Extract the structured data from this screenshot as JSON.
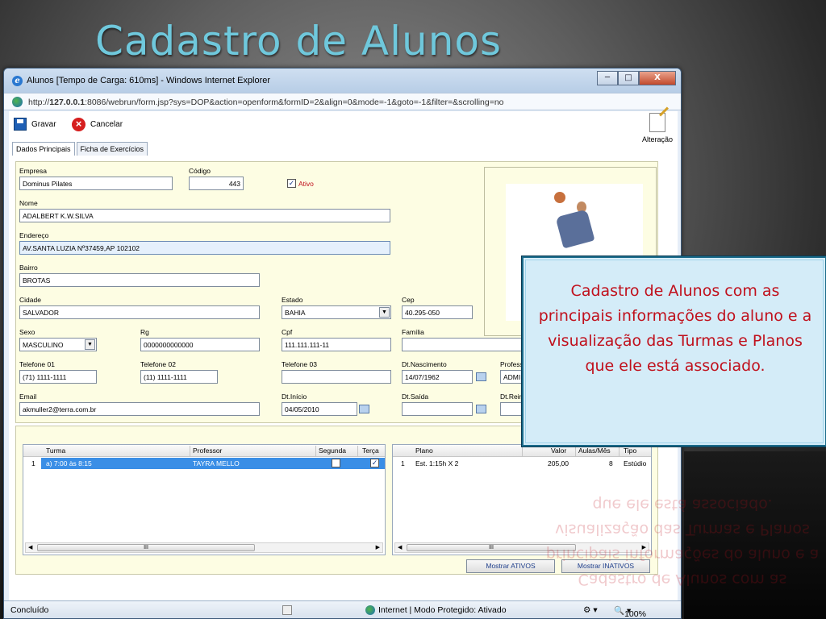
{
  "slide": {
    "title": "Cadastro de Alunos"
  },
  "window": {
    "title": "Alunos [Tempo de Carga: 610ms] - Windows Internet Explorer",
    "minimize": "─",
    "maximize": "□",
    "close": "X",
    "url_prefix": "http://",
    "url_host": "127.0.0.1",
    "url_rest": ":8086/webrun/form.jsp?sys=DOP&action=openform&formID=2&align=0&mode=-1&goto=-1&filter=&scrolling=no"
  },
  "toolbar": {
    "save_label": "Gravar",
    "cancel_label": "Cancelar",
    "alter_label": "Alteração"
  },
  "tabs": [
    {
      "label": "Dados Principais"
    },
    {
      "label": "Ficha de Exercícios"
    }
  ],
  "form": {
    "empresa": {
      "label": "Empresa",
      "value": "Dominus Pilates"
    },
    "codigo": {
      "label": "Código",
      "value": "443"
    },
    "ativo": {
      "label": "Ativo",
      "checked": true
    },
    "nome": {
      "label": "Nome",
      "value": "ADALBERT K.W.SILVA"
    },
    "endereco": {
      "label": "Endereço",
      "value": "AV.SANTA LUZIA Nº37459,AP 102102"
    },
    "bairro": {
      "label": "Bairro",
      "value": "BROTAS"
    },
    "cidade": {
      "label": "Cidade",
      "value": "SALVADOR"
    },
    "estado": {
      "label": "Estado",
      "value": "BAHIA"
    },
    "cep": {
      "label": "Cep",
      "value": "40.295-050"
    },
    "sexo": {
      "label": "Sexo",
      "value": "MASCULINO"
    },
    "rg": {
      "label": "Rg",
      "value": "0000000000000"
    },
    "cpf": {
      "label": "Cpf",
      "value": "111.111.111-11"
    },
    "familia": {
      "label": "Família",
      "value": ""
    },
    "telefone01": {
      "label": "Telefone 01",
      "value": "(71) 1111-1111"
    },
    "telefone02": {
      "label": "Telefone 02",
      "value": "(11) 1111-1111"
    },
    "telefone03": {
      "label": "Telefone 03",
      "value": ""
    },
    "dtnascimento": {
      "label": "Dt.Nascimento",
      "value": "14/07/1962"
    },
    "professor": {
      "label": "Profess",
      "value": "ADMIN"
    },
    "email": {
      "label": "Email",
      "value": "akmuller2@terra.com.br"
    },
    "dtinicio": {
      "label": "Dt.Início",
      "value": "04/05/2010"
    },
    "dtsaida": {
      "label": "Dt.Saída",
      "value": ""
    },
    "dtrein": {
      "label": "Dt.Rein",
      "value": ""
    }
  },
  "turmas_grid": {
    "columns": [
      "Turma",
      "Professor",
      "Segunda",
      "Terça"
    ],
    "rows": [
      {
        "num": "1",
        "turma": "a) 7:00 às 8:15",
        "professor": "TAYRA MELLO",
        "segunda": false,
        "terca": true
      }
    ],
    "scroll_thumb": "III"
  },
  "planos_grid": {
    "columns": [
      "Plano",
      "Valor",
      "Aulas/Mês",
      "Tipo"
    ],
    "rows": [
      {
        "num": "1",
        "plano": "Est. 1:15h X 2",
        "valor": "205,00",
        "aulas": "8",
        "tipo": "Estúdio"
      }
    ],
    "scroll_thumb": "III"
  },
  "buttons": {
    "mostrar_ativos": "Mostrar ATIVOS",
    "mostrar_inativos": "Mostrar INATIVOS"
  },
  "statusbar": {
    "left": "Concluído",
    "zone": "Internet | Modo Protegido: Ativado",
    "zoom": "100%"
  },
  "callout": {
    "text": "Cadastro de Alunos com as principais informações do aluno e a visualização das Turmas e Planos que ele está associado."
  },
  "colors": {
    "title": "#6fc8dc",
    "callout_text": "#c0101c",
    "callout_bg": "#d4ecf8",
    "form_bg": "#fdfde3",
    "selected_row": "#3a8ee6"
  }
}
